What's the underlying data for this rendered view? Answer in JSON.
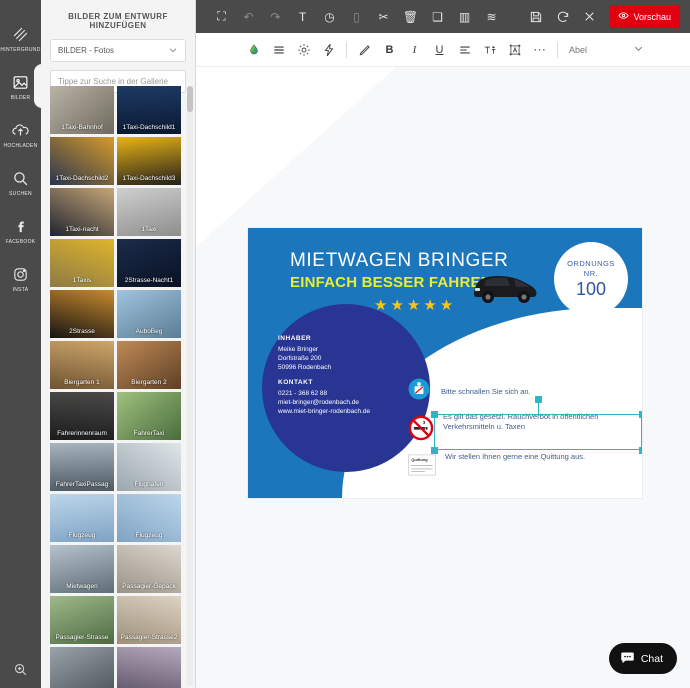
{
  "rail": {
    "items": [
      {
        "label": "HINTERGRUND",
        "icon": "pattern-icon",
        "active": false
      },
      {
        "label": "BILDER",
        "icon": "image-icon",
        "active": true
      },
      {
        "label": "HOCHLADEN",
        "icon": "upload-icon",
        "active": false
      },
      {
        "label": "SUCHEN",
        "icon": "search-icon",
        "active": false
      },
      {
        "label": "FACEBOOK",
        "icon": "facebook-icon",
        "active": false
      },
      {
        "label": "INSTA",
        "icon": "instagram-icon",
        "active": false
      }
    ],
    "zoom_icon": "zoom-in-icon"
  },
  "panel": {
    "title": "BILDER ZUM ENTWURF HINZUFÜGEN",
    "category_value": "BILDER - Fotos",
    "search_placeholder": "Tippe zur Suche in der Gallerie",
    "thumbs": [
      {
        "label": "1Taxi-Bahnhof",
        "c1": "#b9b4a6",
        "c2": "#6f6a5e"
      },
      {
        "label": "1Taxi-Dachschild1",
        "c1": "#1d3a63",
        "c2": "#0b1a33"
      },
      {
        "label": "1Taxi-Dachschild2",
        "c1": "#d69b29",
        "c2": "#2a3550"
      },
      {
        "label": "1Taxi-Dachschild3",
        "c1": "#e8b417",
        "c2": "#23201b"
      },
      {
        "label": "1Taxi-nacht",
        "c1": "#c7a678",
        "c2": "#20252f"
      },
      {
        "label": "1Taxi",
        "c1": "#cfcfcf",
        "c2": "#8d8d8d"
      },
      {
        "label": "1Taxis",
        "c1": "#e0b52b",
        "c2": "#8d7a45"
      },
      {
        "label": "2Strasse-Nacht1",
        "c1": "#1b2b4a",
        "c2": "#091224"
      },
      {
        "label": "2Strasse",
        "c1": "#c98a2c",
        "c2": "#151413"
      },
      {
        "label": "AuboBeg",
        "c1": "#9fc4dd",
        "c2": "#5b7d96"
      },
      {
        "label": "Biergarten 1",
        "c1": "#cfa66a",
        "c2": "#6e5432"
      },
      {
        "label": "Biergarten 2",
        "c1": "#c08a55",
        "c2": "#5d4026"
      },
      {
        "label": "Fahrerinnenraum",
        "c1": "#4b4a49",
        "c2": "#1c1c1c"
      },
      {
        "label": "FahrerTaxi",
        "c1": "#9fc27f",
        "c2": "#4a6c3c"
      },
      {
        "label": "FahrerTaxiPassag",
        "c1": "#a8b4bd",
        "c2": "#4e5a63"
      },
      {
        "label": "Flughafen",
        "c1": "#dfe6ea",
        "c2": "#9aa6ad"
      },
      {
        "label": "Flugzeug",
        "c1": "#bcd6ea",
        "c2": "#7fa3c4"
      },
      {
        "label": "Flugzeug",
        "c1": "#bcd6ea",
        "c2": "#7fa3c4"
      },
      {
        "label": "Mietwagen",
        "c1": "#b6c3cc",
        "c2": "#5f6d77"
      },
      {
        "label": "Passagier-Gepäck",
        "c1": "#dcd7cf",
        "c2": "#9b9287"
      },
      {
        "label": "Passagier-Strasse",
        "c1": "#9fb98a",
        "c2": "#4e6b42"
      },
      {
        "label": "Passagier-Strasse2",
        "c1": "#ddd3c4",
        "c2": "#9d8f79"
      },
      {
        "label": "",
        "c1": "#9aa3ab",
        "c2": "#4c545b"
      },
      {
        "label": "",
        "c1": "#b5a8bc",
        "c2": "#5d5366"
      }
    ]
  },
  "toolbar_top": {
    "buttons": [
      {
        "name": "crop-icon",
        "glyph": "⛶",
        "dim": false
      },
      {
        "name": "undo-icon",
        "glyph": "↶",
        "dim": true
      },
      {
        "name": "redo-icon",
        "glyph": "↷",
        "dim": true
      },
      {
        "name": "text-icon",
        "glyph": "T",
        "dim": false
      },
      {
        "name": "shape-icon",
        "glyph": "◷",
        "dim": false
      },
      {
        "name": "clipboard-icon",
        "glyph": "▯",
        "dim": true
      },
      {
        "name": "cut-icon",
        "glyph": "✂",
        "dim": false
      },
      {
        "name": "delete-icon",
        "glyph": "🗑",
        "dim": false
      },
      {
        "name": "duplicate-icon",
        "glyph": "❏",
        "dim": false
      },
      {
        "name": "align-top-icon",
        "glyph": "▥",
        "dim": false
      },
      {
        "name": "layers-icon",
        "glyph": "≋",
        "dim": false
      }
    ],
    "save_icon": "save-icon",
    "refresh_icon": "refresh-icon",
    "close_icon": "close-icon",
    "preview_label": "Vorschau",
    "preview_icon": "eye-icon",
    "preview_color": "#e1000f"
  },
  "toolbar_format": {
    "buttons": [
      {
        "name": "color-droplet-icon",
        "glyph": "◍"
      },
      {
        "name": "list-lines-icon",
        "glyph": "≡"
      },
      {
        "name": "brightness-icon",
        "glyph": "☼"
      },
      {
        "name": "effects-icon",
        "glyph": "⚡"
      }
    ],
    "buttons2": [
      {
        "name": "pen-icon",
        "glyph": "✎"
      },
      {
        "name": "bold-icon",
        "glyph": "B"
      },
      {
        "name": "italic-icon",
        "glyph": "I"
      },
      {
        "name": "underline-icon",
        "glyph": "U"
      },
      {
        "name": "align-left-icon",
        "glyph": "≡"
      },
      {
        "name": "font-size-icon",
        "glyph": "T↑"
      },
      {
        "name": "text-frame-icon",
        "glyph": "Ⓐ"
      },
      {
        "name": "more-options-icon",
        "glyph": "⋯"
      }
    ],
    "font_name": "Abel",
    "chevron_icon": "chevron-down-icon"
  },
  "card": {
    "title": "MIETWAGEN BRINGER",
    "subtitle": "EINFACH BESSER FAHREN!",
    "stars": "★★★★★",
    "badge": {
      "line1": "ORDNUNGS",
      "line2": "NR.",
      "number": "100"
    },
    "owner_heading": "INHABER",
    "owner_lines": [
      "Meike Bringer",
      "Dorfstraße 200",
      "50996 Rodenbach"
    ],
    "contact_heading": "KONTAKT",
    "contact_lines": [
      "0221 - 368 62 88",
      "miet-bringer@rodenbach.de",
      "www.miet-bringer-rodenbach.de"
    ],
    "features": [
      {
        "icon": "seatbelt-icon",
        "text": "Bitte schnallen Sie sich an."
      },
      {
        "icon": "no-smoking-icon",
        "text": "Es gilt das gesetzl. Rauchverbot in öffentlichen Verkehrsmitteln u. Taxen"
      },
      {
        "icon": "receipt-icon",
        "text": "Wir stellen Ihnen gerne eine Quittung aus."
      }
    ],
    "receipt_label": "Quittung",
    "colors": {
      "bg_blue": "#1b76bc",
      "circle_blue": "#283593",
      "accent_yellow": "#e9ef2a",
      "star_gold": "#f5c518",
      "text_blue": "#3f5c8c",
      "selection": "#2fb4c4"
    }
  },
  "chat": {
    "label": "Chat",
    "icon": "chat-bubble-icon"
  }
}
